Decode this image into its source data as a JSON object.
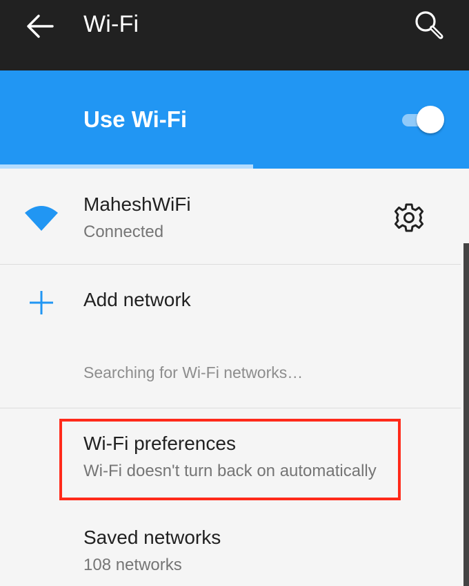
{
  "appbar": {
    "title": "Wi-Fi",
    "back_icon": "arrow-left-icon",
    "search_icon": "search-icon"
  },
  "master_switch": {
    "label": "Use Wi-Fi",
    "state": "on",
    "accent_color": "#2196f3"
  },
  "scan_progress": {
    "fraction": 0.54
  },
  "connected_network": {
    "name": "MaheshWiFi",
    "status": "Connected",
    "signal_icon": "wifi-signal-icon",
    "settings_icon": "gear-icon"
  },
  "add_network": {
    "label": "Add network",
    "icon": "plus-icon"
  },
  "status": {
    "searching": "Searching for Wi-Fi networks…"
  },
  "preferences": {
    "title": "Wi-Fi preferences",
    "summary": "Wi-Fi doesn't turn back on automatically",
    "highlight_color": "#ff2a1a"
  },
  "saved_networks": {
    "title": "Saved networks",
    "summary": "108 networks"
  }
}
